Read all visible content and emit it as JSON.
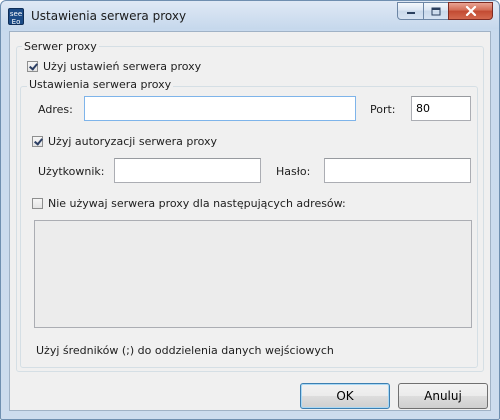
{
  "window": {
    "title": "Ustawienia serwera proxy",
    "icon_text": "see\nEo"
  },
  "titlebar_buttons": [
    "minimize-icon",
    "maximize-icon",
    "close-icon"
  ],
  "proxy_group": {
    "legend": "Serwer proxy",
    "use_proxy": {
      "label": "Użyj ustawień serwera proxy",
      "checked": true
    }
  },
  "settings_group": {
    "legend": "Ustawienia serwera proxy",
    "address_label": "Adres:",
    "address_value": "",
    "port_label": "Port:",
    "port_value": "80",
    "use_auth": {
      "label": "Użyj autoryzacji serwera proxy",
      "checked": true
    },
    "user_label": "Użytkownik:",
    "user_value": "",
    "password_label": "Hasło:",
    "password_value": "",
    "bypass": {
      "label": "Nie używaj serwera proxy dla następujących adresów:",
      "checked": false
    },
    "bypass_list": "",
    "hint": "Użyj średników (;) do oddzielenia danych wejściowych"
  },
  "buttons": {
    "ok": "OK",
    "cancel": "Anuluj"
  }
}
